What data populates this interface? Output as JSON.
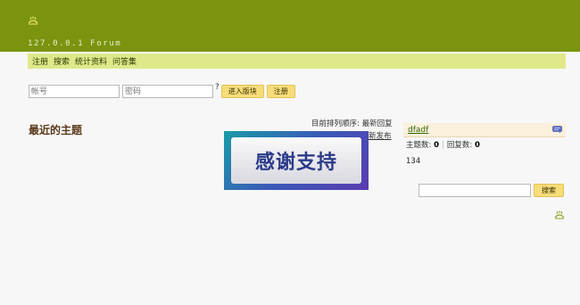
{
  "header": {
    "site_title": "127.0.0.1 Forum",
    "logo_icon": "clover-logo-icon",
    "bg_color": "#7a9410"
  },
  "nav": {
    "items": [
      "注册",
      "搜索",
      "统计资料",
      "问答集"
    ]
  },
  "login": {
    "account_placeholder": "帐号",
    "password_placeholder": "密码",
    "help_mark": "?",
    "enter_board_label": "进入版块",
    "register_label": "注册"
  },
  "main": {
    "recent_title": "最近的主题",
    "sort_prefix": "目前排列顺序: ",
    "sort_option": "最新回复",
    "new_link": "新发布",
    "banner_text": "感谢支持"
  },
  "board": {
    "name": "dfadf",
    "topics_label": "主题数: ",
    "topics_value": "0",
    "replies_label": "回复数: ",
    "replies_value": "0",
    "number": "134",
    "icon": "chat-bubble-icon"
  },
  "search": {
    "button_label": "搜索"
  },
  "colors": {
    "accent": "#7a9410",
    "nav_bg": "#dfe98a",
    "button": "#f7dd7a"
  }
}
